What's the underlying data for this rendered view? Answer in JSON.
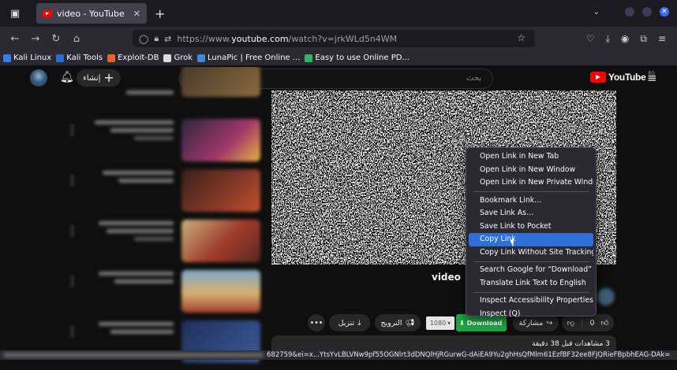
{
  "browser": {
    "tab_title": "video - YouTube",
    "url_prefix": "https://www.",
    "url_domain": "youtube.com",
    "url_path": "/watch?v=jrkWLd5n4WM",
    "bookmarks": [
      {
        "label": "Kali Linux",
        "color": "#367bf0"
      },
      {
        "label": "Kali Tools",
        "color": "#2d6ad9"
      },
      {
        "label": "Exploit-DB",
        "color": "#e5642b"
      },
      {
        "label": "Grok",
        "color": "#dddddd"
      },
      {
        "label": "LunaPic | Free Online ...",
        "color": "#3d8bd9"
      },
      {
        "label": "Easy to use Online PD...",
        "color": "#2fb566"
      }
    ]
  },
  "youtube": {
    "create_label": "إنشاء",
    "search_placeholder": "بحث",
    "logo_text": "YouTube",
    "country_code": "EG",
    "video_title": "video",
    "actions": {
      "download_label": "Download",
      "quality_label": "1080",
      "share_label": "مشاركة",
      "like_count": "0",
      "promote_label": "الترويج",
      "save_label": "تنزيل",
      "more_label": "•••"
    },
    "description_meta": "3 مشاهدات  قبل 38 دقيقة"
  },
  "status_bar": {
    "link_preview": "682759&ei=x...YtsYvLBLVNw9pf55OGNlrt3dDNQlHjRGurwG-dAiEA9Yu2ghHsQfMlm61EzfBF32ee8FJQRieFBpbhEAG-DAk="
  },
  "context_menu": {
    "groups": [
      [
        {
          "label": "Open Link in New Tab",
          "highlighted": false
        },
        {
          "label": "Open Link in New Window",
          "highlighted": false
        },
        {
          "label": "Open Link in New Private Window",
          "highlighted": false
        }
      ],
      [
        {
          "label": "Bookmark Link…",
          "highlighted": false
        },
        {
          "label": "Save Link As…",
          "highlighted": false
        },
        {
          "label": "Save Link to Pocket",
          "highlighted": false
        },
        {
          "label": "Copy Link",
          "highlighted": true
        },
        {
          "label": "Copy Link Without Site Tracking",
          "highlighted": false
        }
      ],
      [
        {
          "label": "Search Google for “Download”",
          "highlighted": false
        },
        {
          "label": "Translate Link Text to English",
          "highlighted": false
        }
      ],
      [
        {
          "label": "Inspect Accessibility Properties",
          "highlighted": false
        },
        {
          "label": "Inspect (Q)",
          "highlighted": false
        }
      ]
    ]
  }
}
